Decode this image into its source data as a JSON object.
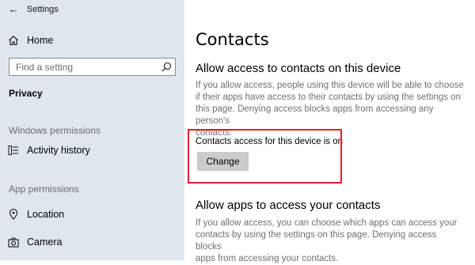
{
  "window": {
    "title": "Settings",
    "back_icon": "arrow-left-icon"
  },
  "sidebar": {
    "home": {
      "label": "Home",
      "icon": "home-icon"
    },
    "search": {
      "placeholder": "Find a setting",
      "icon": "search-icon"
    },
    "category": "Privacy",
    "sections": [
      {
        "header": "Windows permissions",
        "items": [
          {
            "label": "Activity history",
            "icon": "activity-history-icon"
          }
        ]
      },
      {
        "header": "App permissions",
        "items": [
          {
            "label": "Location",
            "icon": "location-icon"
          },
          {
            "label": "Camera",
            "icon": "camera-icon"
          }
        ]
      }
    ]
  },
  "main": {
    "title": "Contacts",
    "section1": {
      "heading": "Allow access to contacts on this device",
      "description_lines": [
        "If you allow access, people using this device will be able to choose",
        "if their apps have access to their contacts by using the settings on",
        "this page. Denying access blocks apps from accessing any person's",
        "contacts."
      ],
      "status": "Contacts access for this device is on",
      "button": "Change"
    },
    "section2": {
      "heading": "Allow apps to access your contacts",
      "description_lines": [
        "If you allow access, you can choose which apps can access your",
        "contacts by using the settings on this page. Denying access blocks",
        "apps from accessing your contacts."
      ]
    },
    "highlight_color": "#e2232a"
  }
}
